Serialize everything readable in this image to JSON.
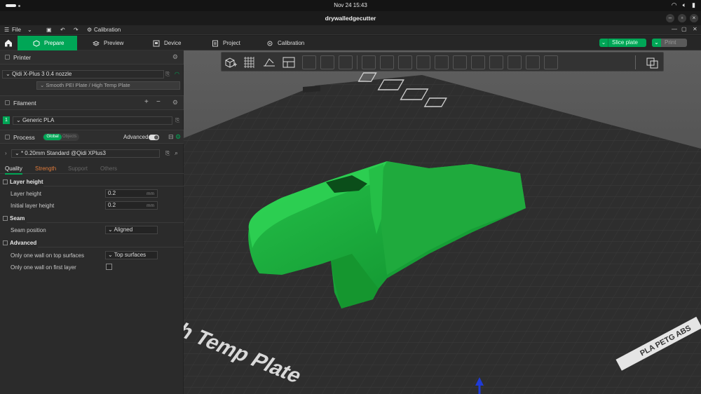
{
  "system": {
    "clock": "Nov 24  15:43"
  },
  "window": {
    "title": "drywalledgecutter"
  },
  "menu": {
    "file": "File",
    "calibration": "Calibration"
  },
  "tabs": [
    {
      "label": "Prepare"
    },
    {
      "label": "Preview"
    },
    {
      "label": "Device"
    },
    {
      "label": "Project"
    },
    {
      "label": "Calibration"
    }
  ],
  "actions": {
    "slice": "Slice plate",
    "print": "Print"
  },
  "printer": {
    "header": "Printer",
    "name": "Qidi X-Plus 3 0.4 nozzle",
    "plate": "Smooth PEI Plate / High Temp Plate"
  },
  "filament": {
    "header": "Filament",
    "index": "1",
    "name": "Generic PLA"
  },
  "process": {
    "header": "Process",
    "toggle_global": "Global",
    "toggle_objects": "Objects",
    "advanced_label": "Advanced",
    "preset": "* 0.20mm Standard @Qidi XPlus3"
  },
  "process_tabs": [
    {
      "label": "Quality"
    },
    {
      "label": "Strength"
    },
    {
      "label": "Support"
    },
    {
      "label": "Others"
    }
  ],
  "groups": {
    "layer_height": {
      "title": "Layer height",
      "rows": [
        {
          "label": "Layer height",
          "value": "0.2",
          "unit": "mm"
        },
        {
          "label": "Initial layer height",
          "value": "0.2",
          "unit": "mm"
        }
      ]
    },
    "seam": {
      "title": "Seam",
      "rows": [
        {
          "label": "Seam position",
          "value": "Aligned"
        }
      ]
    },
    "advanced": {
      "title": "Advanced",
      "rows": [
        {
          "label": "Only one wall on top surfaces",
          "value": "Top surfaces"
        },
        {
          "label": "Only one wall on first layer"
        }
      ]
    }
  },
  "bed": {
    "plate_text": "e / High Temp Plate",
    "label_text": "PLA PETG ABS"
  },
  "colors": {
    "accent": "#00a656",
    "model": "#1a9e3a",
    "bed": "#2e2e2e"
  }
}
